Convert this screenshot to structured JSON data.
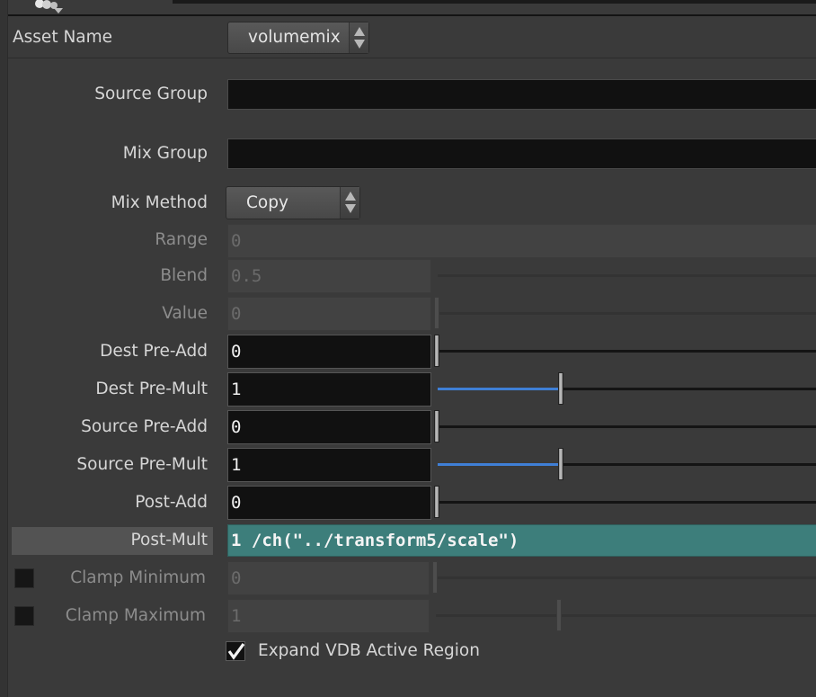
{
  "asset": {
    "label": "Asset Name",
    "value": "volumemix"
  },
  "source_group": {
    "label": "Source Group",
    "value": ""
  },
  "mix_group": {
    "label": "Mix Group",
    "value": ""
  },
  "mix_method": {
    "label": "Mix Method",
    "value": "Copy"
  },
  "range": {
    "label": "Range",
    "value": "0"
  },
  "blend": {
    "label": "Blend",
    "value": "0.5"
  },
  "value": {
    "label": "Value",
    "value": "0"
  },
  "dest_pre_add": {
    "label": "Dest Pre-Add",
    "value": "0"
  },
  "dest_pre_mult": {
    "label": "Dest Pre-Mult",
    "value": "1"
  },
  "source_pre_add": {
    "label": "Source Pre-Add",
    "value": "0"
  },
  "source_pre_mult": {
    "label": "Source Pre-Mult",
    "value": "1"
  },
  "post_add": {
    "label": "Post-Add",
    "value": "0"
  },
  "post_mult": {
    "label": "Post-Mult",
    "value": "1 /ch(\"../transform5/scale\")"
  },
  "clamp_min": {
    "label": "Clamp Minimum",
    "value": "0",
    "checked": false
  },
  "clamp_max": {
    "label": "Clamp Maximum",
    "value": "1",
    "checked": false
  },
  "expand_vdb": {
    "label": "Expand VDB Active Region",
    "checked": true
  },
  "colors": {
    "accent": "#3f7fd6",
    "expression_bg": "#3d7e7b",
    "panel_bg": "#3a3a3a",
    "field_bg": "#111111"
  },
  "icons": {
    "top": "node-icon",
    "menu_arrows": "up-down-arrows-icon",
    "check": "checkmark-icon"
  }
}
